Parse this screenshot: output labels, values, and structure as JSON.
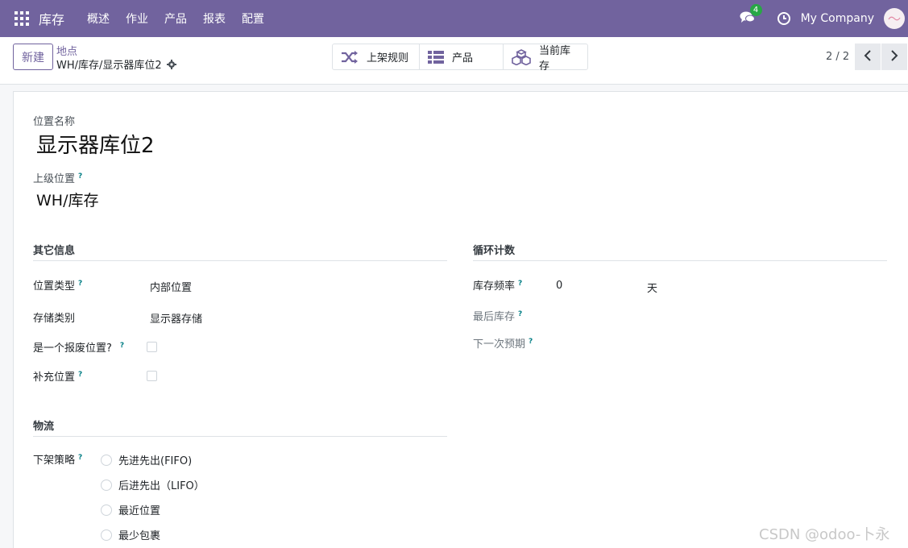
{
  "navbar": {
    "brand": "库存",
    "menu": [
      "概述",
      "作业",
      "产品",
      "报表",
      "配置"
    ],
    "chat_count": "4",
    "company": "My Company",
    "colors": {
      "bar": "#71639e",
      "badge": "#28a745"
    }
  },
  "control_panel": {
    "new_label": "新建",
    "breadcrumb_parent": "地点",
    "breadcrumb_current": "WH/库存/显示器库位2",
    "smart_buttons": [
      {
        "label": "上架规则",
        "icon": "shuffle-icon"
      },
      {
        "label": "产品",
        "icon": "list-icon"
      },
      {
        "label": "当前库存",
        "icon": "cubes-icon"
      }
    ],
    "pager": "2 / 2"
  },
  "form": {
    "name_label": "位置名称",
    "name_value": "显示器库位2",
    "parent_label": "上级位置",
    "parent_value": "WH/库存",
    "help_mark": "?",
    "other_info": {
      "title": "其它信息",
      "location_type_label": "位置类型",
      "location_type_value": "内部位置",
      "storage_category_label": "存储类别",
      "storage_category_value": "显示器存储",
      "scrap_label": "是一个报废位置?",
      "replenish_label": "补充位置"
    },
    "cycle_count": {
      "title": "循环计数",
      "frequency_label": "库存频率",
      "frequency_value": "0",
      "frequency_unit": "天",
      "last_label": "最后库存",
      "next_label": "下一次预期"
    },
    "logistics": {
      "title": "物流",
      "removal_label": "下架策略",
      "options": [
        "先进先出(FIFO)",
        "后进先出（LIFO）",
        "最近位置",
        "最少包裹"
      ]
    }
  },
  "watermark": "CSDN @odoo-卜永"
}
